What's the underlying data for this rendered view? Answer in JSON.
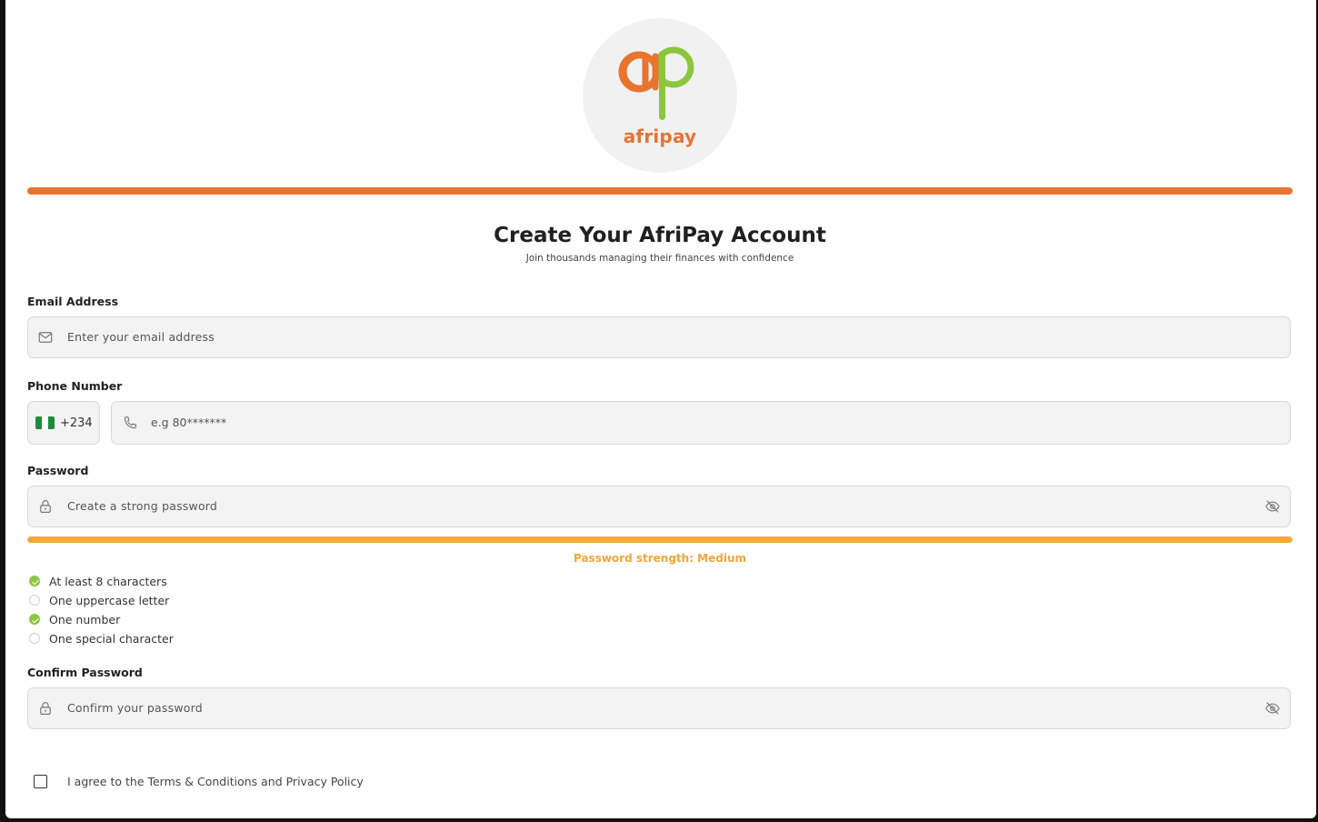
{
  "brand": {
    "wordmark": "afripay",
    "accent": "#e8742f",
    "green": "#8cc63f"
  },
  "header": {
    "title": "Create Your AfriPay Account",
    "subtitle": "Join thousands managing their finances with confidence"
  },
  "form": {
    "email": {
      "label": "Email Address",
      "placeholder": "Enter your email address",
      "icon": "mail-icon"
    },
    "phone": {
      "label": "Phone Number",
      "country_flag": "nigeria-flag",
      "country_code": "+234",
      "placeholder": "e.g 80*******",
      "icon": "phone-icon"
    },
    "password": {
      "label": "Password",
      "placeholder": "Create a strong password",
      "icon": "lock-icon",
      "toggle_icon": "eye-off-icon"
    },
    "strength": {
      "text": "Password strength: Medium",
      "level": 1.0,
      "color": "#f5a93b"
    },
    "requirements": [
      {
        "text": "At least 8 characters",
        "met": true
      },
      {
        "text": "One uppercase letter",
        "met": false
      },
      {
        "text": "One number",
        "met": true
      },
      {
        "text": "One special character",
        "met": false
      }
    ],
    "confirm": {
      "label": "Confirm Password",
      "placeholder": "Confirm your password",
      "icon": "lock-icon",
      "toggle_icon": "eye-off-icon"
    },
    "terms": {
      "text": "I agree to the Terms & Conditions and Privacy Policy",
      "checked": false
    }
  }
}
